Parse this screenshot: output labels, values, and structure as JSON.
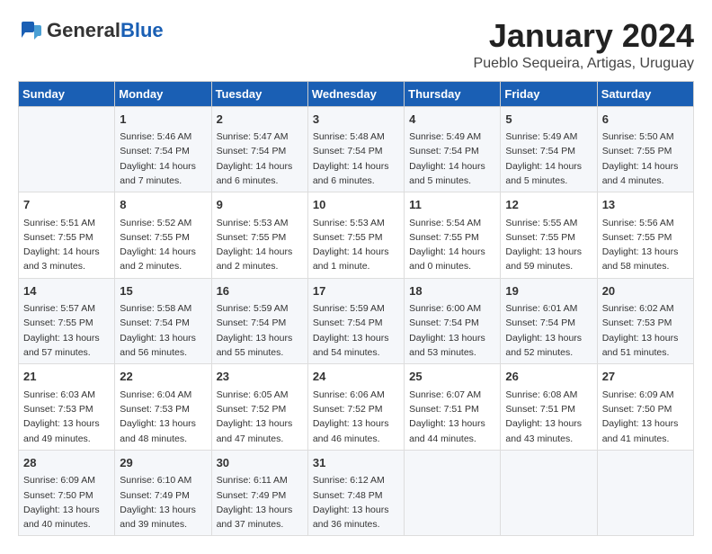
{
  "logo": {
    "general": "General",
    "blue": "Blue"
  },
  "title": "January 2024",
  "location": "Pueblo Sequeira, Artigas, Uruguay",
  "headers": [
    "Sunday",
    "Monday",
    "Tuesday",
    "Wednesday",
    "Thursday",
    "Friday",
    "Saturday"
  ],
  "weeks": [
    [
      {
        "day": "",
        "lines": []
      },
      {
        "day": "1",
        "lines": [
          "Sunrise: 5:46 AM",
          "Sunset: 7:54 PM",
          "Daylight: 14 hours",
          "and 7 minutes."
        ]
      },
      {
        "day": "2",
        "lines": [
          "Sunrise: 5:47 AM",
          "Sunset: 7:54 PM",
          "Daylight: 14 hours",
          "and 6 minutes."
        ]
      },
      {
        "day": "3",
        "lines": [
          "Sunrise: 5:48 AM",
          "Sunset: 7:54 PM",
          "Daylight: 14 hours",
          "and 6 minutes."
        ]
      },
      {
        "day": "4",
        "lines": [
          "Sunrise: 5:49 AM",
          "Sunset: 7:54 PM",
          "Daylight: 14 hours",
          "and 5 minutes."
        ]
      },
      {
        "day": "5",
        "lines": [
          "Sunrise: 5:49 AM",
          "Sunset: 7:54 PM",
          "Daylight: 14 hours",
          "and 5 minutes."
        ]
      },
      {
        "day": "6",
        "lines": [
          "Sunrise: 5:50 AM",
          "Sunset: 7:55 PM",
          "Daylight: 14 hours",
          "and 4 minutes."
        ]
      }
    ],
    [
      {
        "day": "7",
        "lines": [
          "Sunrise: 5:51 AM",
          "Sunset: 7:55 PM",
          "Daylight: 14 hours",
          "and 3 minutes."
        ]
      },
      {
        "day": "8",
        "lines": [
          "Sunrise: 5:52 AM",
          "Sunset: 7:55 PM",
          "Daylight: 14 hours",
          "and 2 minutes."
        ]
      },
      {
        "day": "9",
        "lines": [
          "Sunrise: 5:53 AM",
          "Sunset: 7:55 PM",
          "Daylight: 14 hours",
          "and 2 minutes."
        ]
      },
      {
        "day": "10",
        "lines": [
          "Sunrise: 5:53 AM",
          "Sunset: 7:55 PM",
          "Daylight: 14 hours",
          "and 1 minute."
        ]
      },
      {
        "day": "11",
        "lines": [
          "Sunrise: 5:54 AM",
          "Sunset: 7:55 PM",
          "Daylight: 14 hours",
          "and 0 minutes."
        ]
      },
      {
        "day": "12",
        "lines": [
          "Sunrise: 5:55 AM",
          "Sunset: 7:55 PM",
          "Daylight: 13 hours",
          "and 59 minutes."
        ]
      },
      {
        "day": "13",
        "lines": [
          "Sunrise: 5:56 AM",
          "Sunset: 7:55 PM",
          "Daylight: 13 hours",
          "and 58 minutes."
        ]
      }
    ],
    [
      {
        "day": "14",
        "lines": [
          "Sunrise: 5:57 AM",
          "Sunset: 7:55 PM",
          "Daylight: 13 hours",
          "and 57 minutes."
        ]
      },
      {
        "day": "15",
        "lines": [
          "Sunrise: 5:58 AM",
          "Sunset: 7:54 PM",
          "Daylight: 13 hours",
          "and 56 minutes."
        ]
      },
      {
        "day": "16",
        "lines": [
          "Sunrise: 5:59 AM",
          "Sunset: 7:54 PM",
          "Daylight: 13 hours",
          "and 55 minutes."
        ]
      },
      {
        "day": "17",
        "lines": [
          "Sunrise: 5:59 AM",
          "Sunset: 7:54 PM",
          "Daylight: 13 hours",
          "and 54 minutes."
        ]
      },
      {
        "day": "18",
        "lines": [
          "Sunrise: 6:00 AM",
          "Sunset: 7:54 PM",
          "Daylight: 13 hours",
          "and 53 minutes."
        ]
      },
      {
        "day": "19",
        "lines": [
          "Sunrise: 6:01 AM",
          "Sunset: 7:54 PM",
          "Daylight: 13 hours",
          "and 52 minutes."
        ]
      },
      {
        "day": "20",
        "lines": [
          "Sunrise: 6:02 AM",
          "Sunset: 7:53 PM",
          "Daylight: 13 hours",
          "and 51 minutes."
        ]
      }
    ],
    [
      {
        "day": "21",
        "lines": [
          "Sunrise: 6:03 AM",
          "Sunset: 7:53 PM",
          "Daylight: 13 hours",
          "and 49 minutes."
        ]
      },
      {
        "day": "22",
        "lines": [
          "Sunrise: 6:04 AM",
          "Sunset: 7:53 PM",
          "Daylight: 13 hours",
          "and 48 minutes."
        ]
      },
      {
        "day": "23",
        "lines": [
          "Sunrise: 6:05 AM",
          "Sunset: 7:52 PM",
          "Daylight: 13 hours",
          "and 47 minutes."
        ]
      },
      {
        "day": "24",
        "lines": [
          "Sunrise: 6:06 AM",
          "Sunset: 7:52 PM",
          "Daylight: 13 hours",
          "and 46 minutes."
        ]
      },
      {
        "day": "25",
        "lines": [
          "Sunrise: 6:07 AM",
          "Sunset: 7:51 PM",
          "Daylight: 13 hours",
          "and 44 minutes."
        ]
      },
      {
        "day": "26",
        "lines": [
          "Sunrise: 6:08 AM",
          "Sunset: 7:51 PM",
          "Daylight: 13 hours",
          "and 43 minutes."
        ]
      },
      {
        "day": "27",
        "lines": [
          "Sunrise: 6:09 AM",
          "Sunset: 7:50 PM",
          "Daylight: 13 hours",
          "and 41 minutes."
        ]
      }
    ],
    [
      {
        "day": "28",
        "lines": [
          "Sunrise: 6:09 AM",
          "Sunset: 7:50 PM",
          "Daylight: 13 hours",
          "and 40 minutes."
        ]
      },
      {
        "day": "29",
        "lines": [
          "Sunrise: 6:10 AM",
          "Sunset: 7:49 PM",
          "Daylight: 13 hours",
          "and 39 minutes."
        ]
      },
      {
        "day": "30",
        "lines": [
          "Sunrise: 6:11 AM",
          "Sunset: 7:49 PM",
          "Daylight: 13 hours",
          "and 37 minutes."
        ]
      },
      {
        "day": "31",
        "lines": [
          "Sunrise: 6:12 AM",
          "Sunset: 7:48 PM",
          "Daylight: 13 hours",
          "and 36 minutes."
        ]
      },
      {
        "day": "",
        "lines": []
      },
      {
        "day": "",
        "lines": []
      },
      {
        "day": "",
        "lines": []
      }
    ]
  ]
}
